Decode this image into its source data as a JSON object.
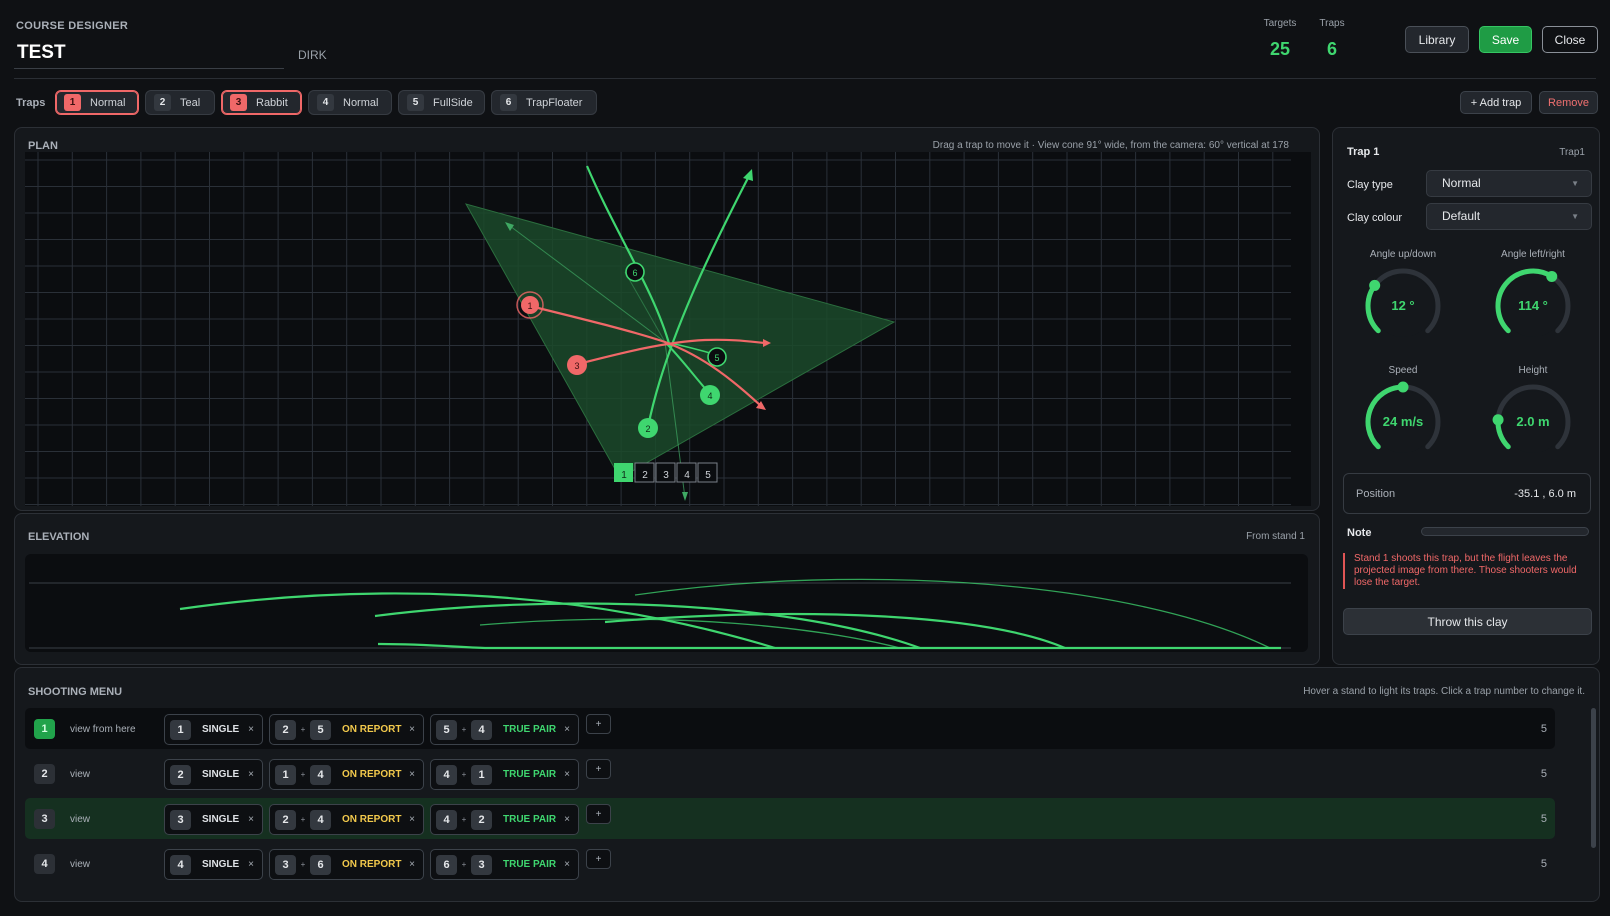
{
  "header": {
    "section_label": "COURSE DESIGNER",
    "course_name": "TEST",
    "author": "DIRK",
    "targets_label": "Targets",
    "targets_value": "25",
    "traps_label": "Traps",
    "traps_value": "6",
    "library_label": "Library",
    "save_label": "Save",
    "close_label": "Close"
  },
  "trapbar": {
    "label": "Traps",
    "chips": [
      {
        "num": "1",
        "label": "Normal"
      },
      {
        "num": "2",
        "label": "Teal"
      },
      {
        "num": "3",
        "label": "Rabbit"
      },
      {
        "num": "4",
        "label": "Normal"
      },
      {
        "num": "5",
        "label": "FullSide"
      },
      {
        "num": "6",
        "label": "TrapFloater"
      }
    ],
    "add_label": "+ Add trap",
    "remove_label": "Remove"
  },
  "plan": {
    "title": "PLAN",
    "hint": "Drag a trap to move it · View cone 91° wide, from the camera: 60° vertical at 178",
    "trap_numbers": [
      "1",
      "2",
      "3",
      "4",
      "5",
      "6"
    ],
    "stand_numbers": [
      "1",
      "2",
      "3",
      "4",
      "5"
    ]
  },
  "elevation": {
    "title": "ELEVATION",
    "subtitle": "From stand 1"
  },
  "trap_panel": {
    "title": "Trap 1",
    "id": "Trap1",
    "clay_type_label": "Clay type",
    "clay_type_value": "Normal",
    "clay_colour_label": "Clay colour",
    "clay_colour_value": "Default",
    "dials": {
      "angle_ud": {
        "label": "Angle up/down",
        "value": "12  °",
        "fraction": 0.3
      },
      "angle_lr": {
        "label": "Angle left/right",
        "value": "114  °",
        "fraction": 0.62
      },
      "speed": {
        "label": "Speed",
        "value": "24  m/s",
        "fraction": 0.5
      },
      "height": {
        "label": "Height",
        "value": "2.0  m",
        "fraction": 0.18
      }
    },
    "position_label": "Position",
    "position_value": "-35.1 , 6.0 m",
    "note_label": "Note",
    "warning": "Stand 1 shoots this trap, but the flight leaves the projected image from there. Those shooters would lose the target.",
    "throw_label": "Throw this clay"
  },
  "menu": {
    "title": "SHOOTING MENU",
    "hint": "Hover a stand to light its traps. Click a trap number to change it.",
    "add_symbol": "+",
    "remove_symbol": "×",
    "plus_symbol": "+",
    "rows": [
      {
        "stand": "1",
        "view": "view from here",
        "count": "5",
        "single": {
          "a": "1",
          "label": "SINGLE"
        },
        "report": {
          "a": "2",
          "b": "5",
          "label": "ON REPORT"
        },
        "pair": {
          "a": "5",
          "b": "4",
          "label": "TRUE PAIR"
        }
      },
      {
        "stand": "2",
        "view": "view",
        "count": "5",
        "single": {
          "a": "2",
          "label": "SINGLE"
        },
        "report": {
          "a": "1",
          "b": "4",
          "label": "ON REPORT"
        },
        "pair": {
          "a": "4",
          "b": "1",
          "label": "TRUE PAIR"
        }
      },
      {
        "stand": "3",
        "view": "view",
        "count": "5",
        "single": {
          "a": "3",
          "label": "SINGLE"
        },
        "report": {
          "a": "2",
          "b": "4",
          "label": "ON REPORT"
        },
        "pair": {
          "a": "4",
          "b": "2",
          "label": "TRUE PAIR"
        }
      },
      {
        "stand": "4",
        "view": "view",
        "count": "5",
        "single": {
          "a": "4",
          "label": "SINGLE"
        },
        "report": {
          "a": "3",
          "b": "6",
          "label": "ON REPORT"
        },
        "pair": {
          "a": "6",
          "b": "3",
          "label": "TRUE PAIR"
        }
      }
    ]
  },
  "colors": {
    "accent_green": "#3fd66f",
    "selected_trap_red": "#f06868",
    "on_report_yellow": "#f2c94c",
    "background": "#0f1114"
  }
}
